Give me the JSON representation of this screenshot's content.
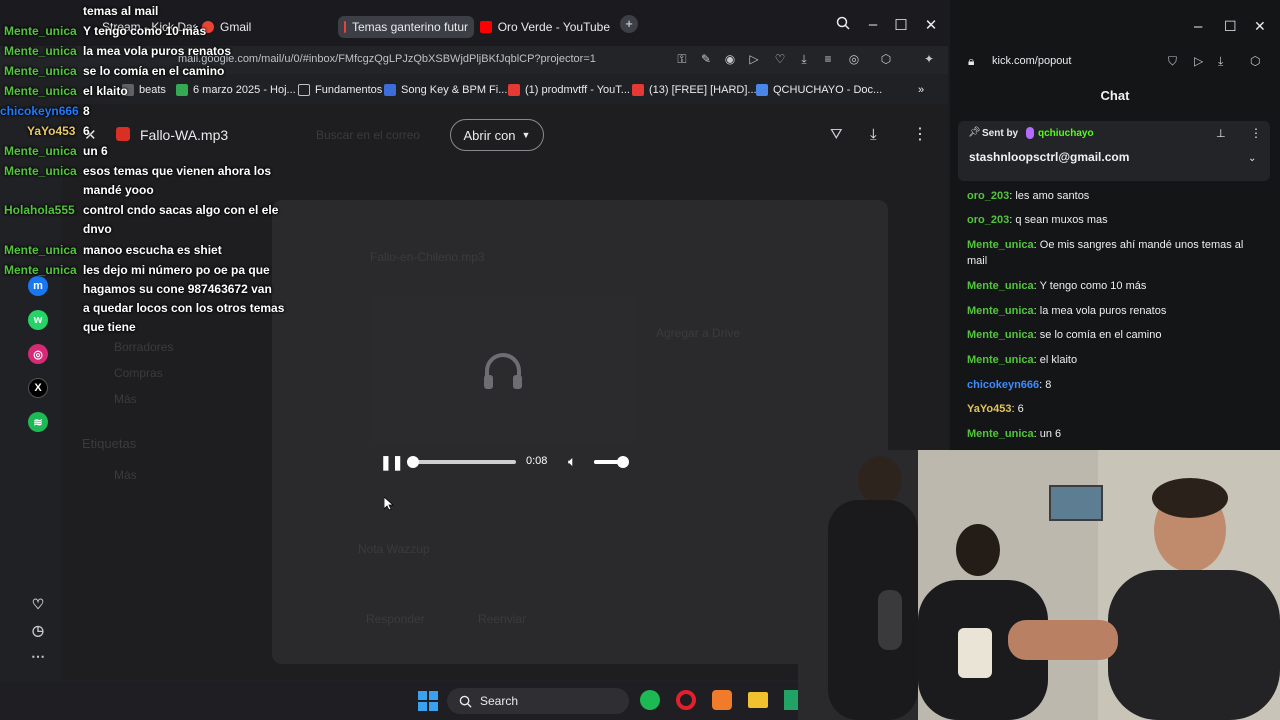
{
  "browser": {
    "tabs": [
      {
        "label": "Stream - Kick Dashbo",
        "icon": "kick-icon"
      },
      {
        "label": "Gmail",
        "icon": "gmail-icon"
      },
      {
        "label": "Temas ganterino futur",
        "icon": "gmail-icon",
        "active": true
      },
      {
        "label": "Oro Verde - YouTube",
        "icon": "youtube-icon"
      }
    ],
    "url": "mail.google.com/mail/u/0/#inbox/FMfcgzQgLPJzQbXSBWjdPljBKfJqblCP?projector=1",
    "bookmarks": [
      {
        "label": "beats",
        "color": "#5f6368"
      },
      {
        "label": "6 marzo 2025 - Hoj...",
        "color": "#34a853"
      },
      {
        "label": "Fundamentos",
        "color": "#5f6368"
      },
      {
        "label": "Song Key & BPM Fi...",
        "color": "#3d6dd8"
      },
      {
        "label": "(1) prodmvtff - YouT...",
        "color": "#e53935"
      },
      {
        "label": "(13) [FREE] [HARD]...",
        "color": "#e53935"
      },
      {
        "label": "QCHUCHAYO - Doc...",
        "color": "#4a86e8"
      }
    ]
  },
  "viewer": {
    "file_name": "Fallo-WA.mp3",
    "open_with_label": "Abrir con",
    "time": "0:08",
    "progress": 0.05,
    "volume": 0.85
  },
  "gmail_dim": {
    "search_placeholder": "Buscar en el correo",
    "attachment": "Fallo-en-Chileno.mp3",
    "drafts": "Borradores",
    "purchases": "Compras",
    "more": "Más",
    "labels": "Etiquetas",
    "more2": "Más",
    "reply": "Responder",
    "forward": "Reenviar",
    "add_drive": "Agregar a Drive",
    "attachment2": "Nota Wazzup"
  },
  "overlay_chat": [
    {
      "name": "",
      "msg": "temas al mail"
    },
    {
      "name": "Mente_unica",
      "msg": "Y tengo como 10 más"
    },
    {
      "name": "Mente_unica",
      "msg": "la mea vola puros renatos"
    },
    {
      "name": "Mente_unica",
      "msg": "se lo comía en el camino"
    },
    {
      "name": "Mente_unica",
      "msg": "el klaito"
    },
    {
      "name": "chicokeyn666",
      "msg": "8",
      "color": "blue"
    },
    {
      "name": "YaYo453",
      "msg": "6",
      "color": "gold"
    },
    {
      "name": "Mente_unica",
      "msg": "un 6"
    },
    {
      "name": "Mente_unica",
      "msg": "esos temas que vienen ahora los",
      "msg2": "mandé yooo"
    },
    {
      "name": "Holahola555",
      "msg": "control cndo sacas algo con el ele",
      "msg2": "dnvo"
    },
    {
      "name": "Mente_unica",
      "msg": "manoo escucha es shiet"
    },
    {
      "name": "Mente_unica",
      "msg": "les dejo mi número po oe pa que",
      "msg2": "hagamos su cone 987463672 van",
      "msg3": "a quedar locos con los otros temas",
      "msg4": "que tiene"
    }
  ],
  "chat_window": {
    "url": "kick.com/popout",
    "title": "Chat",
    "pinned_sent_by": "Sent by",
    "pinned_user": "qchiuchayo",
    "pinned_text": "stashnloopsctrl@gmail.com",
    "messages": [
      {
        "name": "oro_203",
        "text": "les amo santos",
        "color": "green"
      },
      {
        "name": "oro_203",
        "text": "q sean muxos mas",
        "color": "green"
      },
      {
        "name": "Mente_unica",
        "text": "Oe mis sangres ahí mandé unos temas al mail",
        "color": "green"
      },
      {
        "name": "Mente_unica",
        "text": "Y tengo como 10 más",
        "color": "green"
      },
      {
        "name": "Mente_unica",
        "text": "la mea vola puros renatos",
        "color": "green"
      },
      {
        "name": "Mente_unica",
        "text": "se lo comía en el camino",
        "color": "green"
      },
      {
        "name": "Mente_unica",
        "text": "el klaito",
        "color": "green"
      },
      {
        "name": "chicokeyn666",
        "text": "8",
        "color": "blue"
      },
      {
        "name": "YaYo453",
        "text": "6",
        "color": "gold"
      },
      {
        "name": "Mente_unica",
        "text": "un 6",
        "color": "green"
      }
    ]
  },
  "taskbar": {
    "search_label": "Search"
  },
  "colors": {
    "kick_green": "#53fc18",
    "name_green": "#53c53d",
    "name_blue": "#3d8bff",
    "name_gold": "#e3c35a"
  }
}
